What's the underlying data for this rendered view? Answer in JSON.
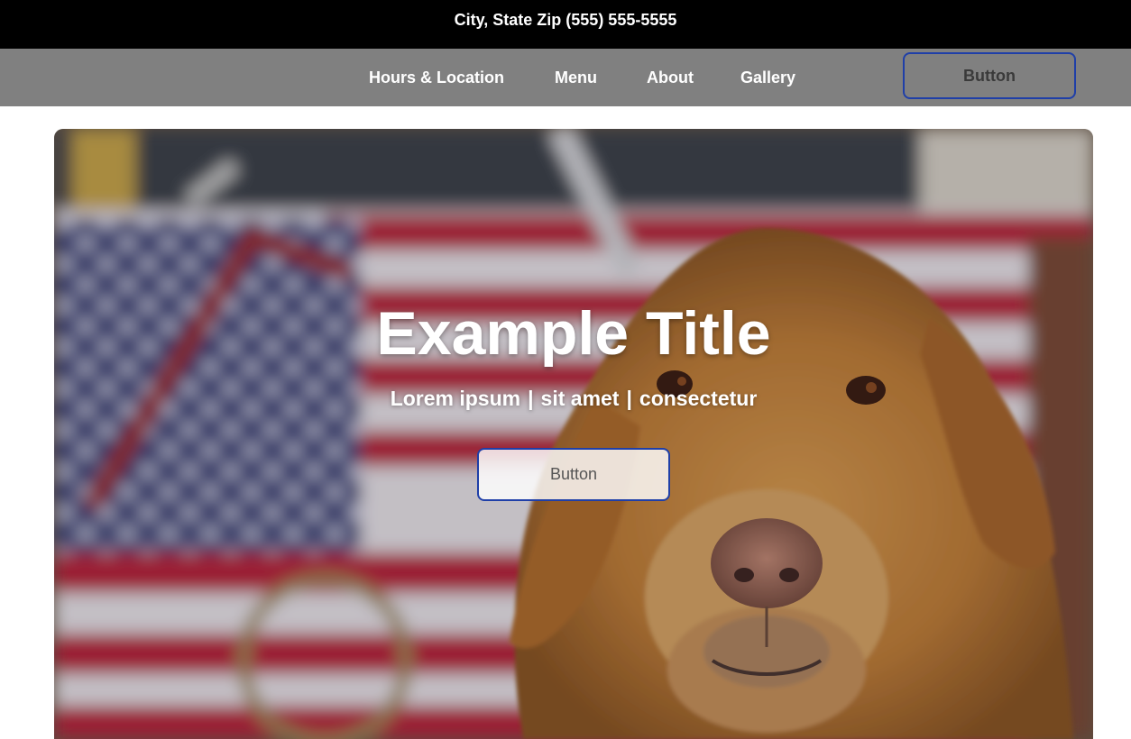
{
  "topbar": {
    "address_phone": "City, State Zip (555) 555-5555"
  },
  "nav": {
    "items": [
      {
        "label": "Hours & Location"
      },
      {
        "label": "Menu"
      },
      {
        "label": "About"
      },
      {
        "label": "Gallery"
      }
    ],
    "button_label": "Button"
  },
  "hero": {
    "title": "Example Title",
    "subtitle_parts": [
      "Lorem ipsum",
      "sit amet",
      "consectetur"
    ],
    "separator": "|",
    "button_label": "Button",
    "image_subject": "golden retriever in front of american flag"
  },
  "colors": {
    "topbar_bg": "#000000",
    "nav_bg": "#808080",
    "button_border": "#1f3fa8"
  }
}
